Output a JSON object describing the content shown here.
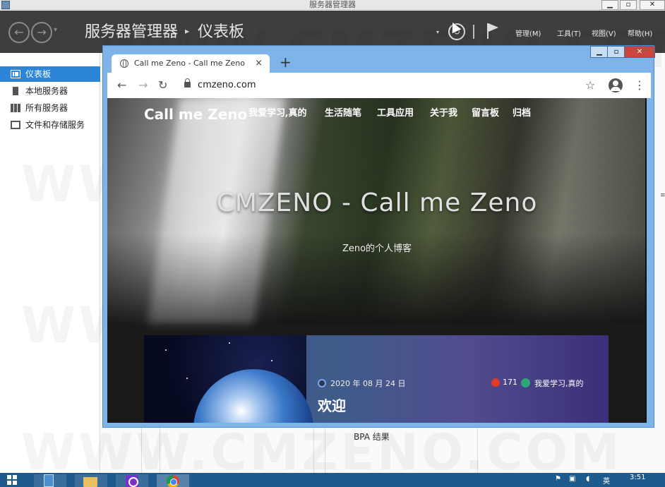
{
  "window": {
    "title": "服务器管理器",
    "controls": {
      "minimize": "▁",
      "restore": "▫",
      "close": "✕"
    }
  },
  "server_manager": {
    "title": "服务器管理器",
    "separator": "▸",
    "page": "仪表板",
    "menus": [
      "管理(M)",
      "工具(T)",
      "视图(V)",
      "帮助(H)"
    ],
    "icons": {
      "back": "arrow-left-icon",
      "forward": "arrow-right-icon",
      "refresh": "refresh-icon",
      "notifications": "flag-icon"
    }
  },
  "sidebar": {
    "items": [
      {
        "label": "仪表板",
        "icon": "dashboard-grid-icon",
        "active": true
      },
      {
        "label": "本地服务器",
        "icon": "server-icon",
        "active": false
      },
      {
        "label": "所有服务器",
        "icon": "servers-icon",
        "active": false
      },
      {
        "label": "文件和存储服务",
        "icon": "storage-icon",
        "active": false
      }
    ]
  },
  "dashboard": {
    "bpa_label": "BPA 结果"
  },
  "browser": {
    "tab_title": "Call me Zeno - Call me Zeno",
    "tab_close": "×",
    "new_tab": "+",
    "url": "cmzeno.com",
    "controls": {
      "minimize": "▁",
      "restore": "▫",
      "close": "✕"
    },
    "toolbar_icons": {
      "back": "←",
      "forward": "→",
      "reload": "↻",
      "star": "☆",
      "menu": "⋮"
    }
  },
  "site": {
    "logo": "Call me Zeno",
    "nav": [
      "我爱学习,真的",
      "生活随笔",
      "工具应用",
      "关于我",
      "留言板",
      "归档"
    ],
    "hero_title": "CMZENO - Call me Zeno",
    "hero_subtitle": "Zeno的个人博客",
    "post": {
      "date": "2020 年 08 月 24 日",
      "views": "171",
      "category": "我爱学习,真的",
      "title": "欢迎"
    }
  },
  "watermark": "WWW.CMZENO.COM",
  "taskbar": {
    "tray": [
      "⚑",
      "▣",
      "◖",
      "英"
    ],
    "clock": "3:51"
  }
}
